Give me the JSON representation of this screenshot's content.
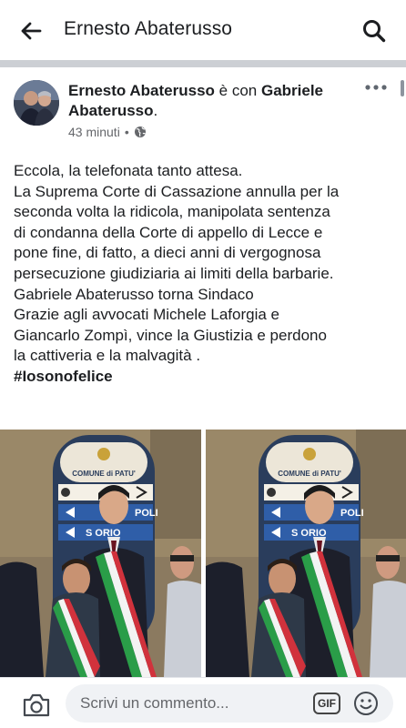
{
  "topbar": {
    "title": "Ernesto Abaterusso",
    "back_icon": "arrow-left-icon",
    "search_icon": "search-icon"
  },
  "post": {
    "author": "Ernesto Abaterusso",
    "with_text": " è con ",
    "tagged": "Gabriele Abaterusso",
    "tagged_suffix": ".",
    "time": "43 minuti",
    "separator": "•",
    "privacy_icon": "globe-icon",
    "more_icon": "more-dots-icon",
    "lines": [
      "Eccola, la telefonata tanto attesa.",
      "La Suprema Corte di Cassazione annulla per la",
      "seconda volta la ridicola, manipolata sentenza",
      "di condanna della Corte di appello di Lecce e",
      "pone fine, di fatto, a dieci anni di vergognosa",
      "persecuzione giudiziaria ai limiti della barbarie.",
      "Gabriele Abaterusso torna Sindaco",
      "Grazie agli avvocati Michele Laforgia e",
      "Giancarlo Zompì, vince la Giustizia e perdono",
      "la cattiveria e la malvagità ."
    ],
    "hashtag": "#Iosonofelice",
    "photo": {
      "sign_title": "COMUNE di PATU'",
      "sign_row1": "POLI",
      "sign_row2": "S    ORIO"
    }
  },
  "composer": {
    "placeholder": "Scrivi un commento...",
    "gif_label": "GIF",
    "camera_icon": "camera-icon",
    "emoji_icon": "smiley-icon"
  }
}
